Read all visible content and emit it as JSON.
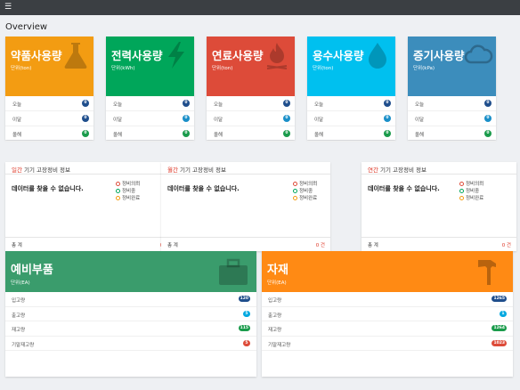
{
  "topbar": {
    "menu_icon": "☰"
  },
  "page_title": "Overview",
  "stat_cards": [
    {
      "title": "약품사용량",
      "unit": "단위(ton)",
      "color": "#f39c12",
      "icon": "flask-icon",
      "rows": [
        {
          "label": "오늘",
          "value": "0",
          "badge_color": "#1f4e8c"
        },
        {
          "label": "이달",
          "value": "0",
          "badge_color": "#1f4e8c"
        },
        {
          "label": "올해",
          "value": "0",
          "badge_color": "#1a9b4b"
        }
      ]
    },
    {
      "title": "전력사용량",
      "unit": "단위(kWh)",
      "color": "#00a65a",
      "icon": "lightning-icon",
      "rows": [
        {
          "label": "오늘",
          "value": "0",
          "badge_color": "#1f4e8c"
        },
        {
          "label": "이달",
          "value": "0",
          "badge_color": "#1a8fc8"
        },
        {
          "label": "올해",
          "value": "0",
          "badge_color": "#1a9b4b"
        }
      ]
    },
    {
      "title": "연료사용량",
      "unit": "단위(ton)",
      "color": "#dd4b39",
      "icon": "fire-icon",
      "rows": [
        {
          "label": "오늘",
          "value": "0",
          "badge_color": "#1f4e8c"
        },
        {
          "label": "이달",
          "value": "0",
          "badge_color": "#1a8fc8"
        },
        {
          "label": "올해",
          "value": "0",
          "badge_color": "#1a9b4b"
        }
      ]
    },
    {
      "title": "용수사용량",
      "unit": "단위(ton)",
      "color": "#00c0ef",
      "icon": "water-drop-icon",
      "rows": [
        {
          "label": "오늘",
          "value": "0",
          "badge_color": "#1f4e8c"
        },
        {
          "label": "이달",
          "value": "0",
          "badge_color": "#1a8fc8"
        },
        {
          "label": "올해",
          "value": "0",
          "badge_color": "#1a9b4b"
        }
      ]
    },
    {
      "title": "증기사용량",
      "unit": "단위(kPa)",
      "color": "#3c8dbc",
      "icon": "cloud-icon",
      "rows": [
        {
          "label": "오늘",
          "value": "0",
          "badge_color": "#1f4e8c"
        },
        {
          "label": "이달",
          "value": "0",
          "badge_color": "#1a8fc8"
        },
        {
          "label": "올해",
          "value": "0",
          "badge_color": "#1a9b4b"
        }
      ]
    }
  ],
  "repair_cards": [
    {
      "period": "일간",
      "title": " 기기 고장정비 정보",
      "no_data": "데이터를 찾을 수 없습니다.",
      "total_label": "총 계",
      "total_value": "0 건"
    },
    {
      "period": "월간",
      "title": " 기기 고장정비 정보",
      "no_data": "데이터를 찾을 수 없습니다.",
      "total_label": "총 계",
      "total_value": "0 건"
    },
    {
      "period": "연간",
      "title": " 기기 고장정비 정보",
      "no_data": "데이터를 찾을 수 없습니다.",
      "total_label": "총 계",
      "total_value": "0 건"
    }
  ],
  "repair_legend": [
    {
      "label": "정비의뢰",
      "color": "#dd4b39"
    },
    {
      "label": "정비중",
      "color": "#00a65a"
    },
    {
      "label": "정비완료",
      "color": "#f39c12"
    }
  ],
  "big_cards": [
    {
      "title": "예비부품",
      "unit": "단위(EA)",
      "color": "#3a9c6c",
      "icon": "toolbox-icon",
      "rows": [
        {
          "label": "입고량",
          "value": "120",
          "badge_color": "#1f4e8c"
        },
        {
          "label": "출고량",
          "value": "5",
          "badge_color": "#00a8e0"
        },
        {
          "label": "재고량",
          "value": "115",
          "badge_color": "#1a9b4b"
        },
        {
          "label": "기말재고량",
          "value": "5",
          "badge_color": "#dd4b39"
        }
      ]
    },
    {
      "title": "자재",
      "unit": "단위(EA)",
      "color": "#ff8a14",
      "icon": "hammer-icon",
      "rows": [
        {
          "label": "입고량",
          "value": "1265",
          "badge_color": "#1f4e8c"
        },
        {
          "label": "출고량",
          "value": "1",
          "badge_color": "#00a8e0"
        },
        {
          "label": "재고량",
          "value": "1264",
          "badge_color": "#1a9b4b"
        },
        {
          "label": "기말재고량",
          "value": "1023",
          "badge_color": "#dd4b39"
        }
      ]
    }
  ]
}
